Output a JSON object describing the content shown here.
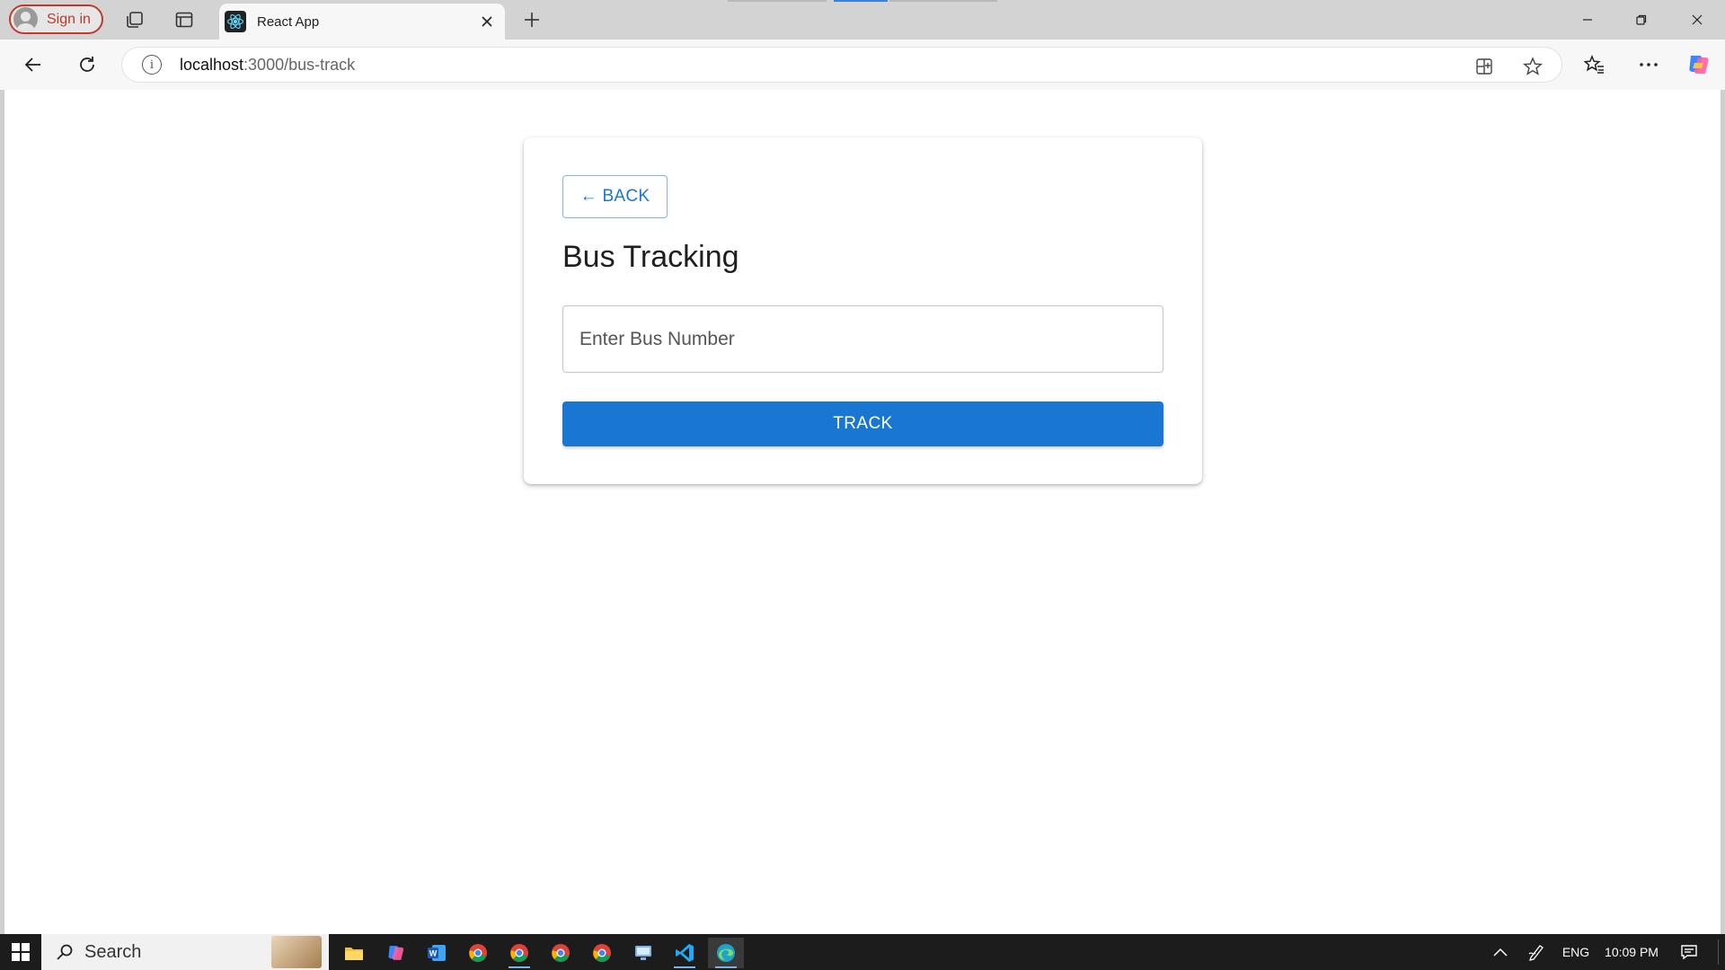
{
  "browser": {
    "signin_label": "Sign in",
    "tab": {
      "title": "React App",
      "favicon": "react-icon"
    },
    "address": {
      "host": "localhost",
      "path": ":3000/bus-track"
    },
    "icons": [
      "workspaces-icon",
      "tab-actions-icon",
      "new-tab-icon",
      "back-icon",
      "refresh-icon",
      "info-icon",
      "app-available-icon",
      "favorite-star-icon",
      "favorites-icon",
      "more-icon",
      "copilot-icon"
    ]
  },
  "page": {
    "back_label": "← BACK",
    "title": "Bus Tracking",
    "bus_input": {
      "placeholder": "Enter Bus Number",
      "value": ""
    },
    "track_label": "TRACK",
    "accent_color": "#1976d2"
  },
  "taskbar": {
    "search_label": "Search",
    "language": "ENG",
    "time": "10:09 PM",
    "apps": [
      "file-explorer-icon",
      "copilot-app-icon",
      "word-icon",
      "chrome-icon",
      "chrome-icon",
      "chrome-icon",
      "chrome-icon",
      "network-manager-icon",
      "vscode-icon",
      "edge-icon"
    ]
  }
}
